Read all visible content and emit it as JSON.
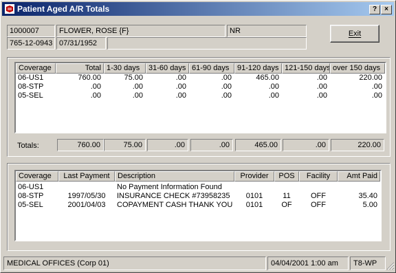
{
  "window": {
    "title": "Patient Aged A/R Totals",
    "help_btn": "?",
    "close_btn": "×"
  },
  "patient": {
    "id": "1000007",
    "name": "FLOWER, ROSE  {F}",
    "code": "NR",
    "ssn": "765-12-0943",
    "dob": "07/31/1952",
    "extra": ""
  },
  "exit_label": "Exit",
  "aging": {
    "headers": [
      "Coverage",
      "Total",
      "1-30 days",
      "31-60 days",
      "61-90 days",
      "91-120 days",
      "121-150 days",
      "over 150 days"
    ],
    "rows": [
      [
        "06-US1",
        "760.00",
        "75.00",
        ".00",
        ".00",
        "465.00",
        ".00",
        "220.00"
      ],
      [
        "08-STP",
        ".00",
        ".00",
        ".00",
        ".00",
        ".00",
        ".00",
        ".00"
      ],
      [
        "05-SEL",
        ".00",
        ".00",
        ".00",
        ".00",
        ".00",
        ".00",
        ".00"
      ]
    ],
    "totals_label": "Totals:",
    "totals": [
      "760.00",
      "75.00",
      ".00",
      ".00",
      "465.00",
      ".00",
      "220.00"
    ]
  },
  "payments": {
    "headers": [
      "Coverage",
      "Last Payment",
      "Description",
      "Provider",
      "POS",
      "Facility",
      "Amt Paid"
    ],
    "rows": [
      [
        "06-US1",
        "",
        "No Payment Information Found",
        "",
        "",
        "",
        ""
      ],
      [
        "08-STP",
        "1997/05/30",
        "INSURANCE CHECK #73958235",
        "0101",
        "11",
        "OFF",
        "35.40"
      ],
      [
        "05-SEL",
        "2001/04/03",
        "COPAYMENT CASH THANK YOU",
        "0101",
        "OF",
        "OFF",
        "5.00"
      ]
    ]
  },
  "statusbar": {
    "office": "MEDICAL OFFICES (Corp 01)",
    "datetime": "04/04/2001  1:00 am",
    "station": "T8-WP"
  }
}
